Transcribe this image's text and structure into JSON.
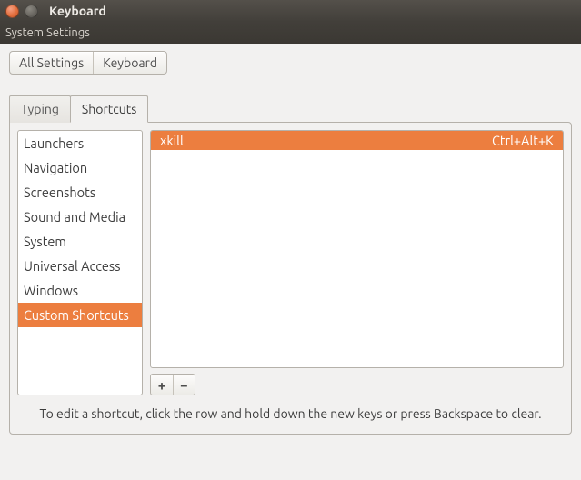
{
  "window": {
    "title": "Keyboard",
    "menu_label": "System Settings"
  },
  "breadcrumb": {
    "all_settings": "All Settings",
    "current": "Keyboard"
  },
  "tabs": {
    "typing": "Typing",
    "shortcuts": "Shortcuts",
    "active": "shortcuts"
  },
  "categories": [
    "Launchers",
    "Navigation",
    "Screenshots",
    "Sound and Media",
    "System",
    "Universal Access",
    "Windows",
    "Custom Shortcuts"
  ],
  "selected_category_index": 7,
  "shortcuts": [
    {
      "name": "xkill",
      "accel": "Ctrl+Alt+K",
      "selected": true
    }
  ],
  "buttons": {
    "add": "+",
    "remove": "−"
  },
  "hint": "To edit a shortcut, click the row and hold down the new keys or press Backspace to clear."
}
